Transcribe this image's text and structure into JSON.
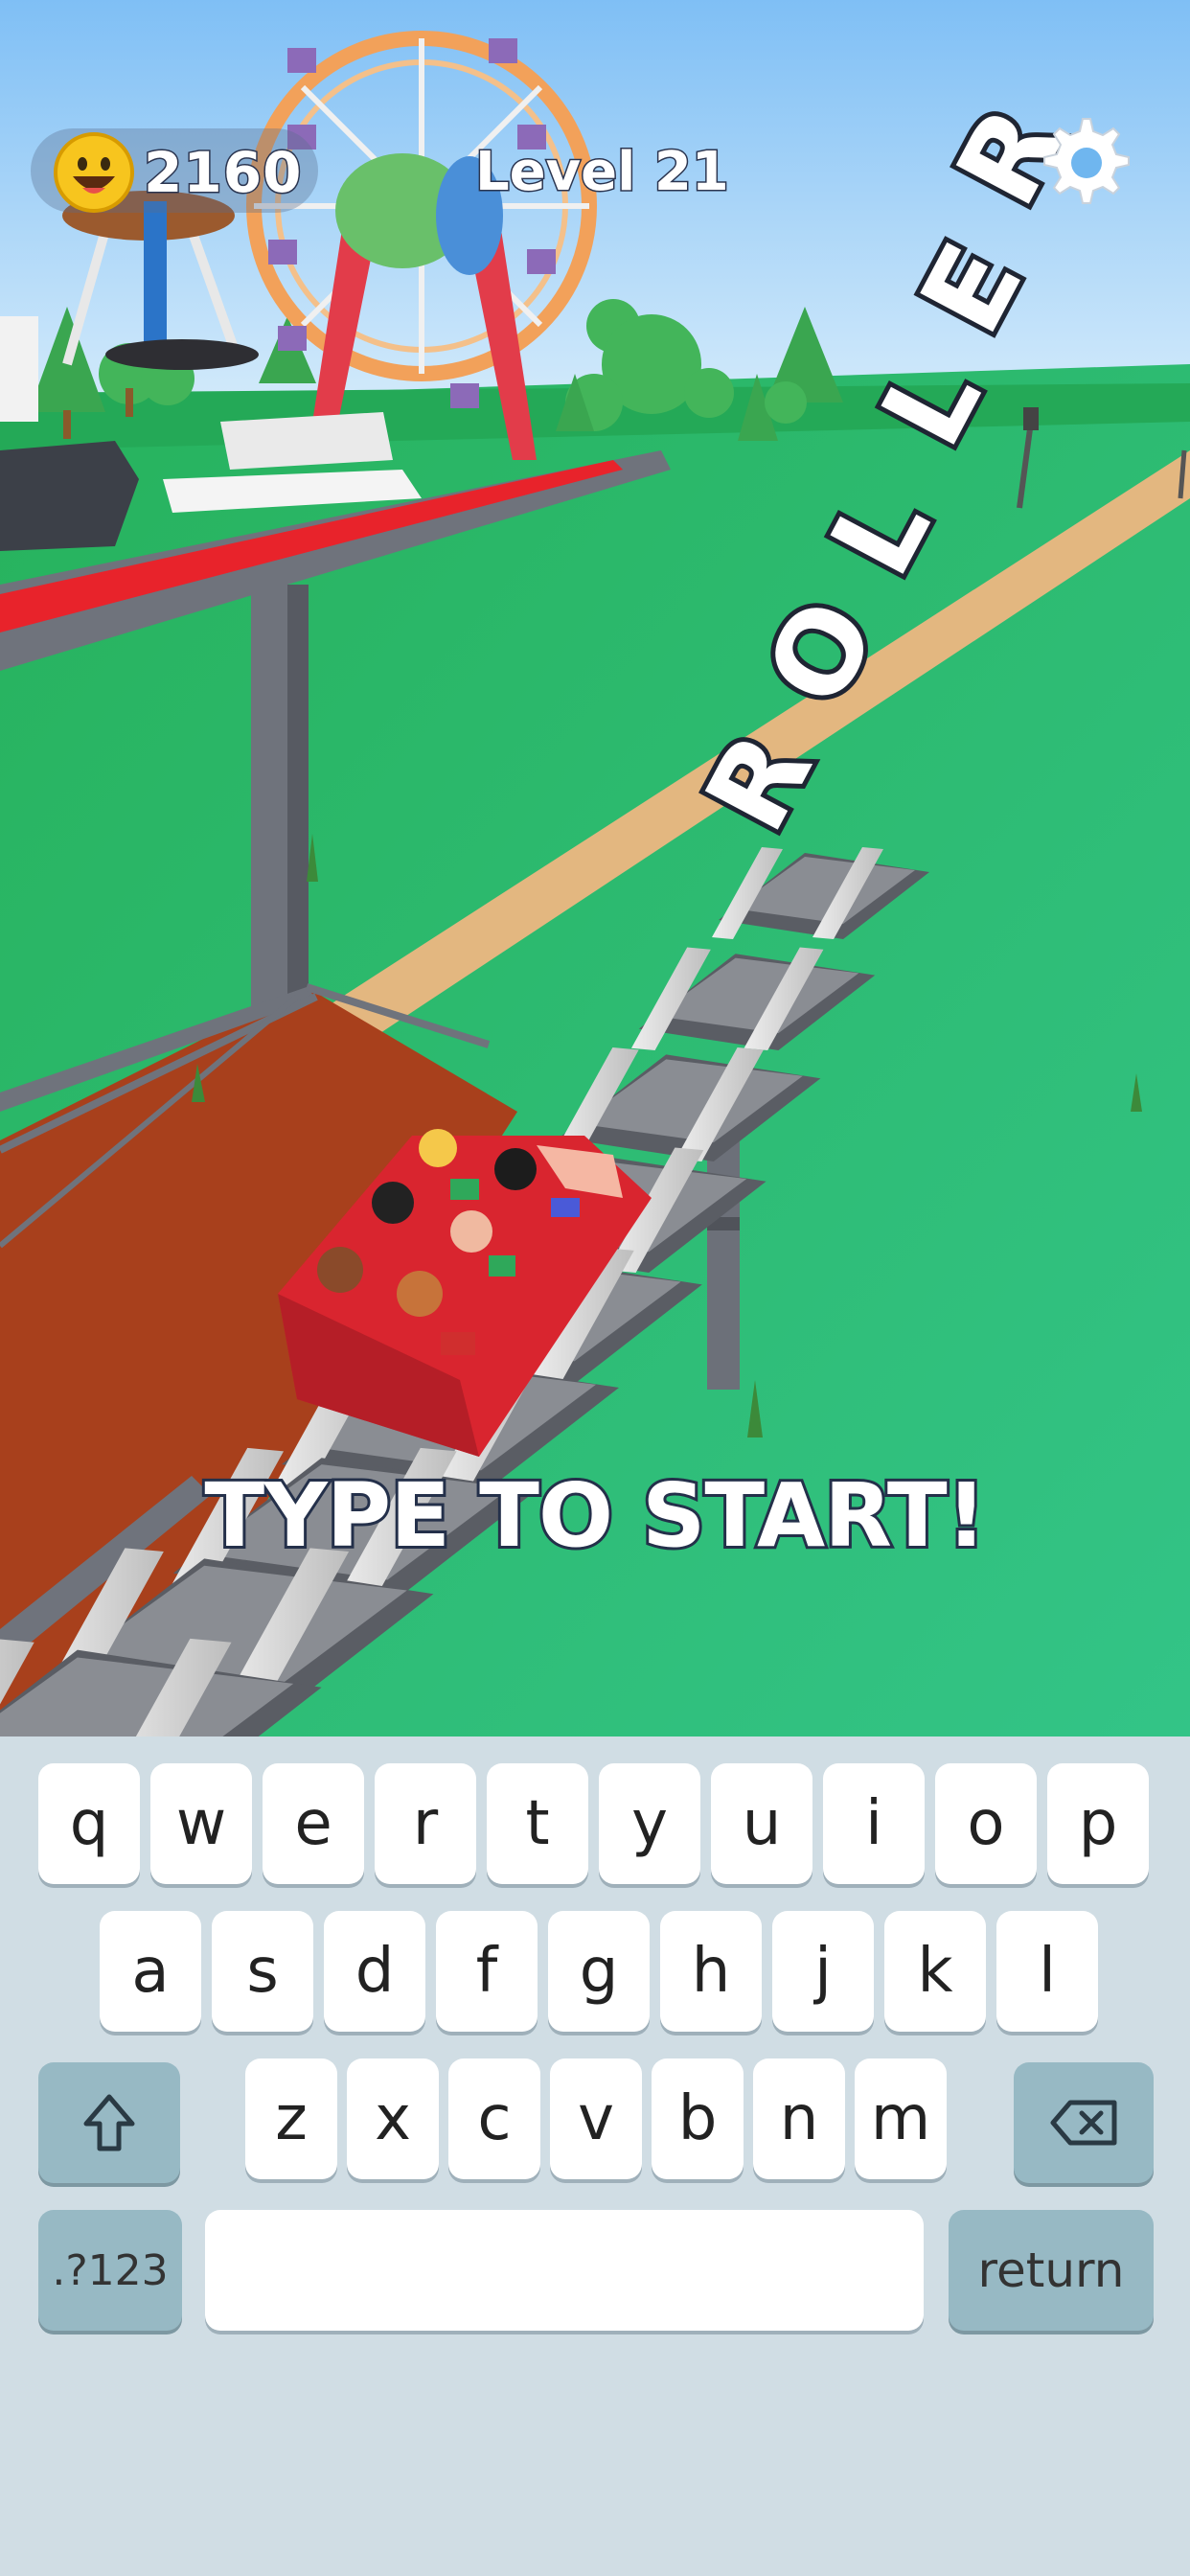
{
  "hud": {
    "coins": "2160",
    "level": "Level 21",
    "coin_icon": "smiley-coin-icon",
    "settings_icon": "gear-icon"
  },
  "game": {
    "track_word": [
      "R",
      "O",
      "L",
      "L",
      "E",
      "R"
    ],
    "prompt": "TYPE TO START!"
  },
  "keyboard": {
    "row1": [
      "q",
      "w",
      "e",
      "r",
      "t",
      "y",
      "u",
      "i",
      "o",
      "p"
    ],
    "row2": [
      "a",
      "s",
      "d",
      "f",
      "g",
      "h",
      "j",
      "k",
      "l"
    ],
    "row3": [
      "z",
      "x",
      "c",
      "v",
      "b",
      "n",
      "m"
    ],
    "shift_icon": "shift-arrow-icon",
    "delete_icon": "backspace-icon",
    "numbers_label": ".?123",
    "return_label": "return"
  },
  "colors": {
    "sky": "#8ec8f4",
    "grass": "#2fbf68",
    "platform": "#a8401c",
    "coaster_car": "#d9252f",
    "keyboard_bg": "#d0dde4",
    "dark_key": "#97b9c4"
  }
}
